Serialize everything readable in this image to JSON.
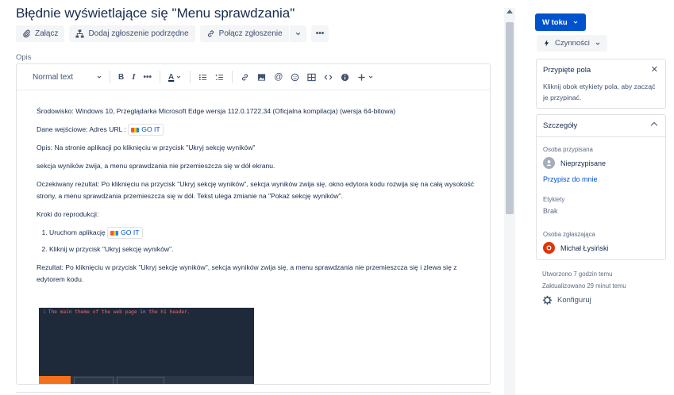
{
  "issue": {
    "title": "Błędnie wyświetlające się \"Menu sprawdzania\""
  },
  "actions": {
    "attach": "Załącz",
    "add_child": "Dodaj zgłoszenie podrzędne",
    "link_issue": "Połącz zgłoszenie",
    "more": "•••"
  },
  "description": {
    "label": "Opis",
    "toolbar": {
      "text_style": "Normal text",
      "bold": "B",
      "italic": "I",
      "more_formatting": "•••",
      "text_color": "A"
    },
    "env": "Środowisko: Windows 10, Przeglądarka Microsoft Edge wersja 112.0.1722.34 (Oficjalna kompilacja) (wersja 64-bitowa)",
    "input_prefix": "Dane wejściowe: Adres URL :",
    "link_text": "GO IT",
    "opis": "Opis:  Na stronie aplikacji po kliknięciu w przycisk \"Ukryj sekcję wyników\"",
    "opis2": "sekcja wyników zwija, a menu sprawdzania nie przemieszcza się w dół ekranu.",
    "expected": "Oczekiwany rezultat: Po kliknięciu na przycisk \"Ukryj sekcję wyników\", sekcja wyników zwija się, okno edytora kodu rozwija się na całą wysokość strony, a menu sprawdzania przemieszcza się w dół. Tekst ulega zmianie na \"Pokaż sekcję wyników\".",
    "steps_title": "Kroki do reprodukcji:",
    "step1_prefix": "Uruchom aplikację",
    "step2": "Kliknij w przycisk \"Ukryj sekcję wyników\".",
    "result": "Rezultat: Po kliknięciu w przycisk \"Ukryj sekcję wyników\", sekcja wyników zwija się, a menu sprawdzania nie przemieszcza się i zlewa się z edytorem kodu.",
    "code_image": {
      "line_number": "1",
      "code_a": "The main theme of the web page ",
      "code_kw": "in",
      "code_b": " the h1 header."
    }
  },
  "sidebar": {
    "status": "W toku",
    "actions": "Czynności",
    "pinned": {
      "title": "Przypięte pola",
      "text": "Kliknij  obok etykiety pola, aby zacząć je przypinać."
    },
    "details": {
      "title": "Szczegóły",
      "assignee_label": "Osoba przypisana",
      "assignee_value": "Nieprzypisane",
      "assign_me": "Przypisz do mnie",
      "labels_label": "Etykiety",
      "labels_value": "Brak",
      "reporter_label": "Osoba zgłaszająca",
      "reporter_value": "Michał Łysiński"
    },
    "created": "Utworzono 7 godzin temu",
    "updated": "Zaktualizowano 29 minut temu",
    "configure": "Konfiguruj"
  }
}
